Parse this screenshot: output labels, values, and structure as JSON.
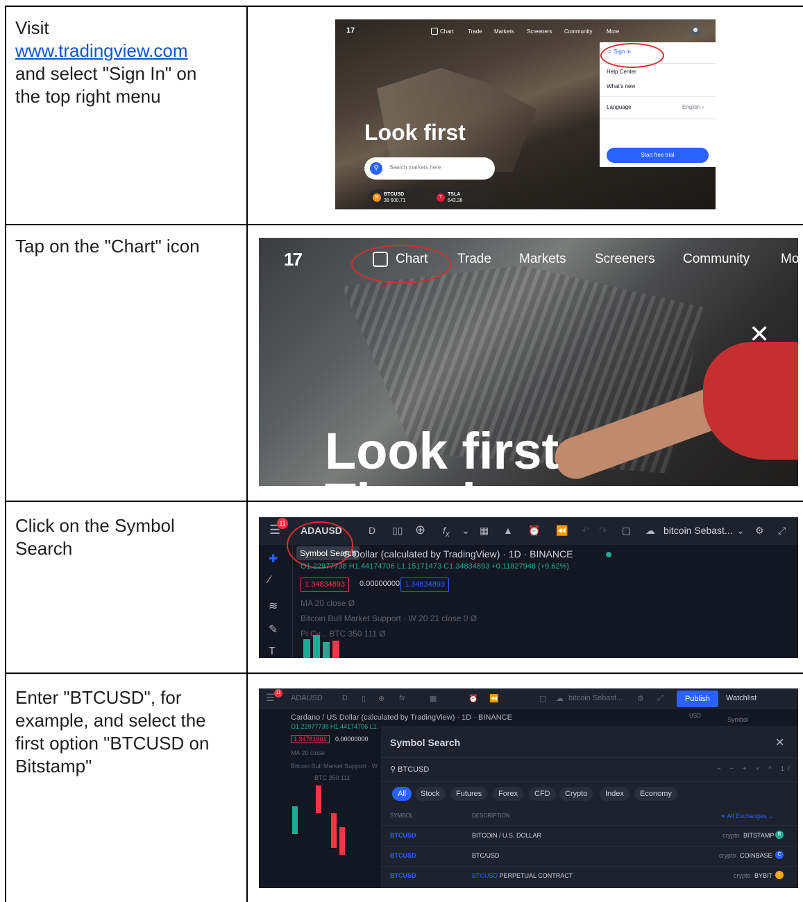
{
  "rows": [
    {
      "instruction_line1": "Visit",
      "instruction_link": "www.tradingview.com",
      "instruction_rest": "and select \"Sign In\" on the top right menu"
    },
    {
      "instruction": "Tap on the \"Chart\" icon"
    },
    {
      "instruction": "Click on the Symbol Search"
    },
    {
      "instruction": "Enter \"BTCUSD\", for example, and select the first option \"BTCUSD on Bitstamp\""
    }
  ],
  "shot1": {
    "logo": "17",
    "nav": [
      "Chart",
      "Trade",
      "Markets",
      "Screeners",
      "Community",
      "More"
    ],
    "menu": {
      "sign_in": "Sign in",
      "help_center": "Help Center",
      "whats_new": "What's new",
      "language_label": "Language",
      "language_value": "English",
      "trial_button": "Start free trial"
    },
    "headline": "Look first",
    "search_placeholder": "Search markets here",
    "tickers": [
      {
        "name": "BTCUSD",
        "price": "38 600.71",
        "icon_color": "#f7931a",
        "icon": "B"
      },
      {
        "name": "TSLA",
        "price": "643.38",
        "icon_color": "#e31937",
        "icon": "T"
      }
    ]
  },
  "shot2": {
    "logo": "17",
    "nav": [
      "Chart",
      "Trade",
      "Markets",
      "Screeners",
      "Community",
      "Mo"
    ],
    "headline": "Look first",
    "headline2": "Then le"
  },
  "shot3": {
    "badge": "11",
    "symbol": "ADAUSD",
    "interval": "D",
    "tooltip": "Symbol Search",
    "layout_name": "bitcoin Sebast...",
    "info": "S Dollar (calculated by TradingView) · 1D · BINANCE",
    "ohlc": "O1.22977738 H1.44174706 L1.15171473 C1.34834893 +0.11827948 (+9.62%)",
    "box_sell": "1.34834893",
    "box_mid": "0.00000000",
    "box_buy": "1.34834893",
    "indicators": [
      "MA 20 close",
      "Bitcoin Bull Market Support · W 20 21 close 0",
      "Pi Cy... BTC 350 111"
    ]
  },
  "shot4": {
    "badge": "11",
    "symbol": "ADAUSD",
    "interval": "D",
    "layout_name": "bitcoin Sebast...",
    "publish": "Publish",
    "watchlist": "Watchlist",
    "info": "Cardano / US Dollar (calculated by TradingView) · 1D · BINANCE",
    "ohlc": "O1.22977738 H1.44174706 L1.",
    "box_sell": "1.34781901",
    "box_mid": "0.00000000",
    "currency": "USD",
    "symbol_col": "Symbol",
    "ind1": "MA 20 close",
    "ind2": "Bitcoin Bull Market Support · W",
    "ind3": "BTC 350 111",
    "modal_title": "Symbol Search",
    "search_value": "BTCUSD",
    "filters": [
      "All",
      "Stock",
      "Futures",
      "Forex",
      "CFD",
      "Crypto",
      "Index",
      "Economy"
    ],
    "col_symbol": "SYMBOL",
    "col_description": "DESCRIPTION",
    "all_exchanges": "All Exchanges",
    "results": [
      {
        "symbol": "BTCUSD",
        "description": "BITCOIN / U.S. DOLLAR",
        "type": "crypto",
        "exchange": "BITSTAMP",
        "icon": "B",
        "icon_color": "#22ab94"
      },
      {
        "symbol": "BTCUSD",
        "description": "BTC/USD",
        "type": "crypto",
        "exchange": "COINBASE",
        "icon": "C",
        "icon_color": "#2962ff"
      },
      {
        "symbol": "BTCUSD",
        "description": "PERPETUAL CONTRACT",
        "type": "crypto",
        "exchange": "BYBIT",
        "icon": "•",
        "icon_color": "#f7a600"
      }
    ]
  }
}
